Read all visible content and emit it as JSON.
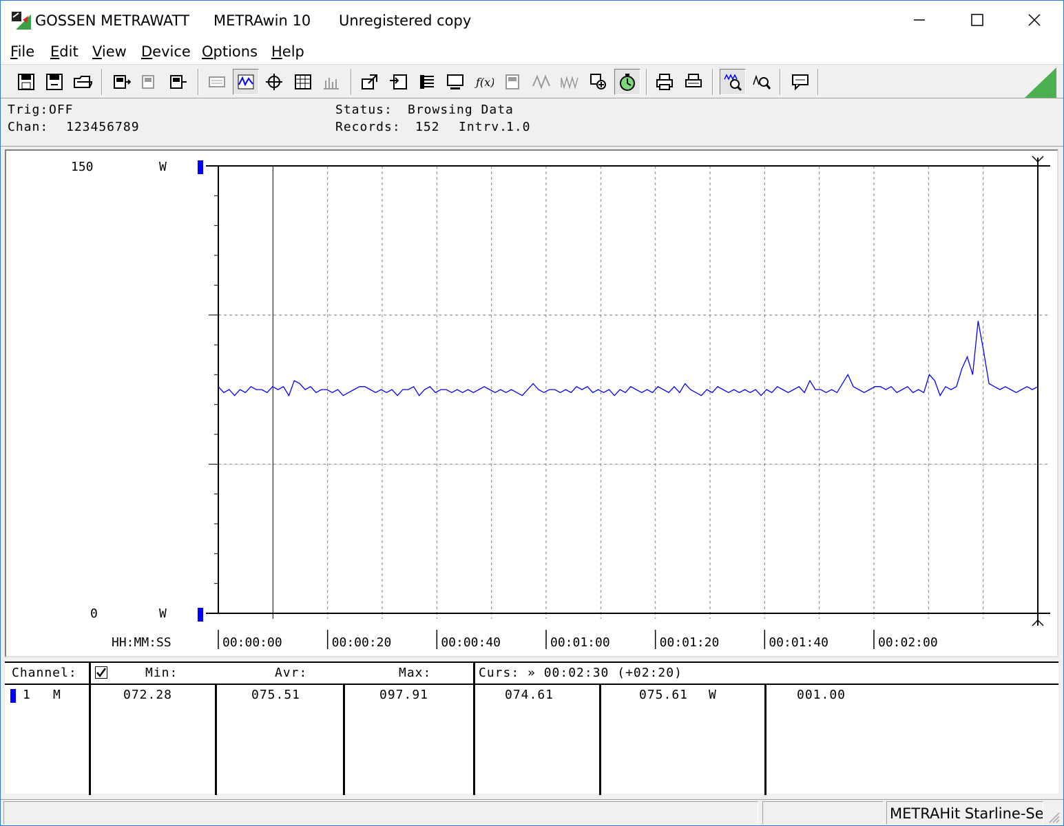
{
  "titlebar": {
    "brand": "GOSSEN METRAWATT",
    "app": "METRAwin 10",
    "note": "Unregistered copy"
  },
  "menu": [
    {
      "label": "File"
    },
    {
      "label": "Edit"
    },
    {
      "label": "View"
    },
    {
      "label": "Device"
    },
    {
      "label": "Options"
    },
    {
      "label": "Help"
    }
  ],
  "status": {
    "trig_label": "Trig:",
    "trig_value": "OFF",
    "chan_label": "Chan:",
    "chan_value": "123456789",
    "status_label": "Status:",
    "status_value": "Browsing Data",
    "records_label": "Records:",
    "records_value": "152",
    "intrv_label": "Intrv.",
    "intrv_value": "1.0"
  },
  "chart": {
    "y_max_label": "150",
    "y_min_label": "0",
    "y_unit": "W",
    "x_axis_label": "HH:MM:SS",
    "x_ticks": [
      "00:00:00",
      "00:00:20",
      "00:00:40",
      "00:01:00",
      "00:01:20",
      "00:01:40",
      "00:02:00"
    ],
    "line_color": "#0000ff",
    "marker_color": "#0000ff"
  },
  "chart_data": {
    "type": "line",
    "xlabel": "HH:MM:SS",
    "ylabel": "W",
    "ylim": [
      0,
      150
    ],
    "xlim_seconds": [
      0,
      150
    ],
    "grid": true,
    "cursor_seconds": 150,
    "series": [
      {
        "values": [
          76,
          74,
          75,
          73,
          75,
          74,
          76,
          75,
          75,
          74,
          76,
          75,
          76,
          73,
          78,
          77,
          75,
          76,
          74,
          75,
          75,
          74,
          75,
          73,
          74,
          75,
          76,
          76,
          75,
          74,
          75,
          74,
          75,
          73,
          75,
          75,
          76,
          73,
          75,
          76,
          74,
          75,
          75,
          74,
          75,
          74,
          75,
          74,
          75,
          76,
          75,
          74,
          75,
          74,
          75,
          74,
          73,
          75,
          77,
          75,
          74,
          75,
          75,
          74,
          75,
          74,
          76,
          75,
          76,
          74,
          75,
          74,
          75,
          73,
          75,
          74,
          76,
          75,
          74,
          75,
          74,
          76,
          75,
          74,
          76,
          74,
          77,
          75,
          74,
          73,
          75,
          74,
          76,
          75,
          74,
          75,
          74,
          75,
          74,
          75,
          73,
          75,
          74,
          76,
          75,
          74,
          75,
          76,
          74,
          78,
          75,
          75,
          74,
          75,
          74,
          77,
          80,
          76,
          75,
          74,
          75,
          76,
          76,
          75,
          76,
          74,
          75,
          76,
          74,
          75,
          74,
          80,
          78,
          73,
          76,
          75,
          76,
          82,
          86,
          80,
          98,
          88,
          77,
          76,
          75,
          76,
          75,
          74,
          75,
          76,
          75,
          76
        ]
      }
    ]
  },
  "table": {
    "headers": {
      "channel": "Channel:",
      "min": "Min:",
      "avr": "Avr:",
      "max": "Max:",
      "curs": "Curs: » 00:02:30 (+02:20)"
    },
    "rows": [
      {
        "num": "1",
        "mode": "M",
        "min": "072.28",
        "avr": "075.51",
        "max": "097.91",
        "curs1": "074.61",
        "curs2": "075.61",
        "unit": "W",
        "extra": "001.00"
      }
    ]
  },
  "statusbar": {
    "device": "METRAHit Starline-Seri"
  },
  "colors": {
    "accent_green": "#4caf50",
    "window_border": "#2b79d7"
  }
}
